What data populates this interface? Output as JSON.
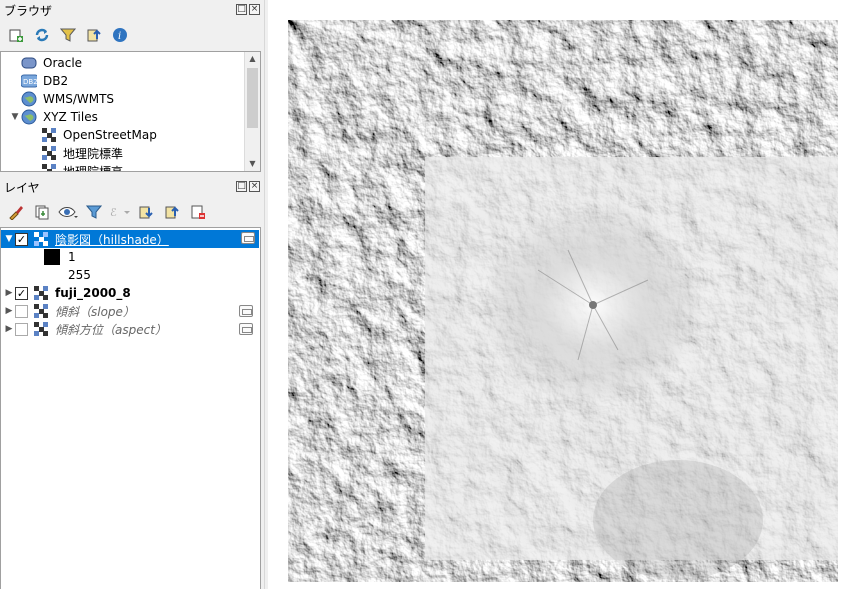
{
  "browser_panel": {
    "title": "ブラウザ",
    "items": [
      {
        "label": "Oracle",
        "icon": "database-icon"
      },
      {
        "label": "DB2",
        "icon": "db2-icon"
      },
      {
        "label": "WMS/WMTS",
        "icon": "globe-icon"
      },
      {
        "label": "XYZ Tiles",
        "icon": "globe-icon",
        "expanded": true
      },
      {
        "label": "OpenStreetMap",
        "icon": "tile-layer-icon",
        "child": true
      },
      {
        "label": "地理院標準",
        "icon": "tile-layer-icon",
        "child": true
      },
      {
        "label": "地理院標高",
        "icon": "tile-layer-icon",
        "child": true
      }
    ]
  },
  "layers_panel": {
    "title": "レイヤ",
    "layers": [
      {
        "label": "陰影図（hillshade）",
        "checked": true,
        "selected": true,
        "expanded": true
      },
      {
        "label": "fuji_2000_8",
        "checked": true,
        "bold": true
      },
      {
        "label": "傾斜（slope）",
        "checked": false,
        "italic": true
      },
      {
        "label": "傾斜方位（aspect）",
        "checked": false,
        "italic": true
      }
    ],
    "legend": {
      "min_value": "1",
      "max_value": "255"
    }
  },
  "colors": {
    "selection": "#0078d7",
    "panel_bg": "#f0f0f0",
    "canvas_bg": "#ffffff"
  }
}
